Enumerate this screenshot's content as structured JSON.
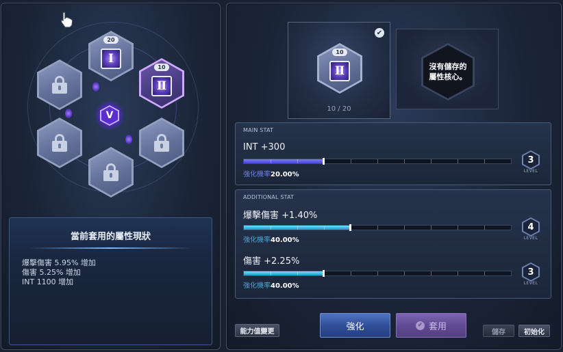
{
  "core_grid": {
    "slots": [
      {
        "state": "locked"
      },
      {
        "state": "equipped",
        "level": "20",
        "glyph": "Ⅰ"
      },
      {
        "state": "selected",
        "level": "10",
        "glyph": "Ⅱ"
      },
      {
        "state": "locked"
      },
      {
        "state": "locked"
      },
      {
        "state": "locked"
      }
    ],
    "center_glyph": "V"
  },
  "applied_status": {
    "title": "當前套用的屬性現狀",
    "lines": [
      "爆擊傷害 5.95% 增加",
      "傷害 5.25% 增加",
      "INT 1100 增加"
    ]
  },
  "selected_core": {
    "level": "10",
    "glyph": "Ⅱ",
    "progress": "10 / 20",
    "check": "✔"
  },
  "empty_slot": {
    "line1": "沒有儲存的",
    "line2": "屬性核心。"
  },
  "main_stat": {
    "header": "MAIN STAT",
    "label": "INT +300",
    "rate_label": "強化機率",
    "rate_value": "20.00%",
    "progress": 0.3,
    "level": "3",
    "level_text": "LEVEL"
  },
  "additional_stat": {
    "header": "ADDITIONAL STAT",
    "items": [
      {
        "label": "爆擊傷害 +1.40%",
        "rate_label": "強化機率",
        "rate_value": "40.00%",
        "progress": 0.4,
        "level": "4",
        "level_text": "LEVEL"
      },
      {
        "label": "傷害 +2.25%",
        "rate_label": "強化機率",
        "rate_value": "40.00%",
        "progress": 0.3,
        "level": "3",
        "level_text": "LEVEL"
      }
    ]
  },
  "buttons": {
    "stat_change": "能力值變更",
    "enhance": "強化",
    "apply": "套用",
    "save": "儲存",
    "reset": "初始化"
  },
  "colors": {
    "accent_purple": "#cfa8ff",
    "main_bar": "#5a55e0",
    "additional_bar": "#2fb4e6",
    "enhance_button": "#3a5cad",
    "apply_button": "#6c549f"
  }
}
